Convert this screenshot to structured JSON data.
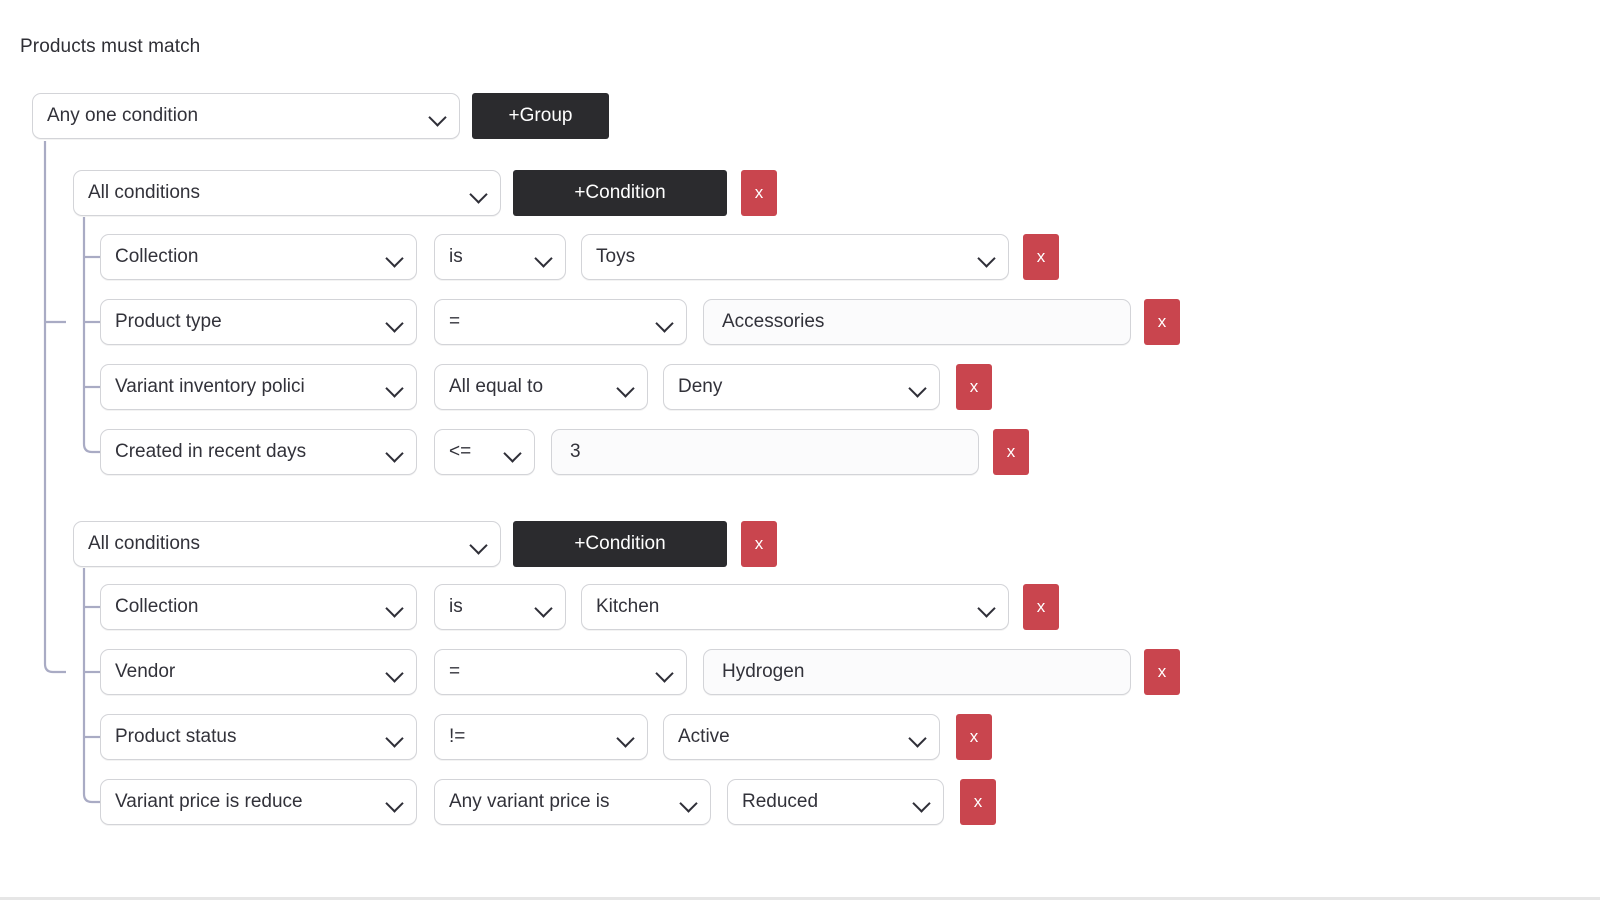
{
  "page": {
    "title": "Products must match"
  },
  "root": {
    "match_mode": "Any one condition",
    "add_group_label": "+Group"
  },
  "groups": [
    {
      "match_mode": "All conditions",
      "add_condition_label": "+Condition",
      "remove_label": "x",
      "conditions": [
        {
          "field": "Collection",
          "field_type": "select",
          "operator": "is",
          "operator_type": "select",
          "value": "Toys",
          "value_type": "select",
          "remove_label": "x"
        },
        {
          "field": "Product type",
          "field_type": "select",
          "operator": "=",
          "operator_type": "select",
          "value": "Accessories",
          "value_type": "text",
          "remove_label": "x"
        },
        {
          "field": "Variant inventory polici",
          "field_type": "select",
          "operator": "All equal to",
          "operator_type": "select",
          "value": "Deny",
          "value_type": "select",
          "remove_label": "x"
        },
        {
          "field": "Created in recent days",
          "field_type": "select",
          "operator": "<=",
          "operator_type": "select",
          "value": "3",
          "value_type": "text",
          "remove_label": "x"
        }
      ]
    },
    {
      "match_mode": "All conditions",
      "add_condition_label": "+Condition",
      "remove_label": "x",
      "conditions": [
        {
          "field": "Collection",
          "field_type": "select",
          "operator": "is",
          "operator_type": "select",
          "value": "Kitchen",
          "value_type": "select",
          "remove_label": "x"
        },
        {
          "field": "Vendor",
          "field_type": "select",
          "operator": "=",
          "operator_type": "select",
          "value": "Hydrogen",
          "value_type": "text",
          "remove_label": "x"
        },
        {
          "field": "Product status",
          "field_type": "select",
          "operator": "!=",
          "operator_type": "select",
          "value": "Active",
          "value_type": "select",
          "remove_label": "x"
        },
        {
          "field": "Variant price is reduce",
          "field_type": "select",
          "operator": "Any variant price is",
          "operator_type": "select",
          "value": "Reduced",
          "value_type": "select",
          "remove_label": "x"
        }
      ]
    }
  ],
  "colors": {
    "accent_dark": "#2b2b2e",
    "danger": "#c9454e",
    "border": "#d3d4d8",
    "tree_line": "#a9abc4",
    "text": "#32323a"
  }
}
